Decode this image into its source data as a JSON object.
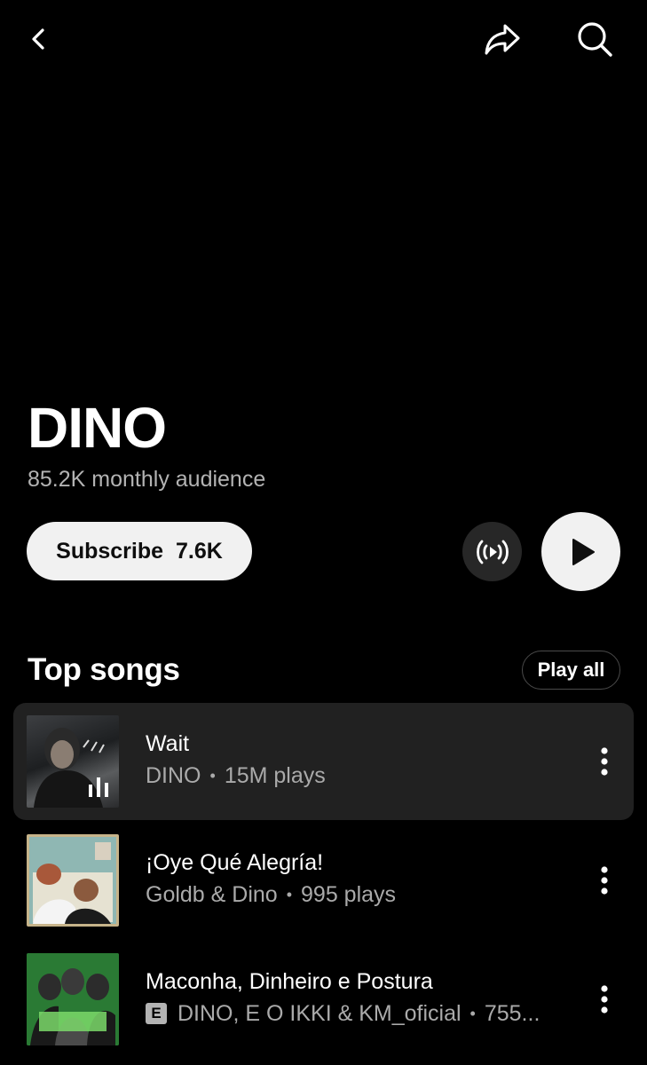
{
  "header": {
    "back_icon": "chevron-left-icon",
    "share_icon": "share-arrow-icon",
    "search_icon": "search-icon"
  },
  "artist": {
    "name": "DINO",
    "audience": "85.2K monthly audience"
  },
  "actions": {
    "subscribe_label": "Subscribe",
    "subscribe_count": "7.6K",
    "radio_icon": "radio-broadcast-icon",
    "play_icon": "play-icon"
  },
  "top_songs": {
    "title": "Top songs",
    "play_all_label": "Play all",
    "songs": [
      {
        "title": "Wait",
        "artist": "DINO",
        "plays": "15M plays",
        "explicit": false,
        "now_playing": true
      },
      {
        "title": "¡Oye Qué Alegría!",
        "artist": "Goldb & Dino",
        "plays": "995 plays",
        "explicit": false,
        "now_playing": false
      },
      {
        "title": "Maconha, Dinheiro e Postura",
        "artist": "DINO, E O IKKI & KM_oficial",
        "plays": "755...",
        "explicit": true,
        "explicit_badge": "E",
        "now_playing": false
      }
    ]
  },
  "colors": {
    "background": "#000000",
    "active_row": "#212121",
    "secondary_text": "#aaaaaa",
    "button_light": "#f1f1f1"
  }
}
